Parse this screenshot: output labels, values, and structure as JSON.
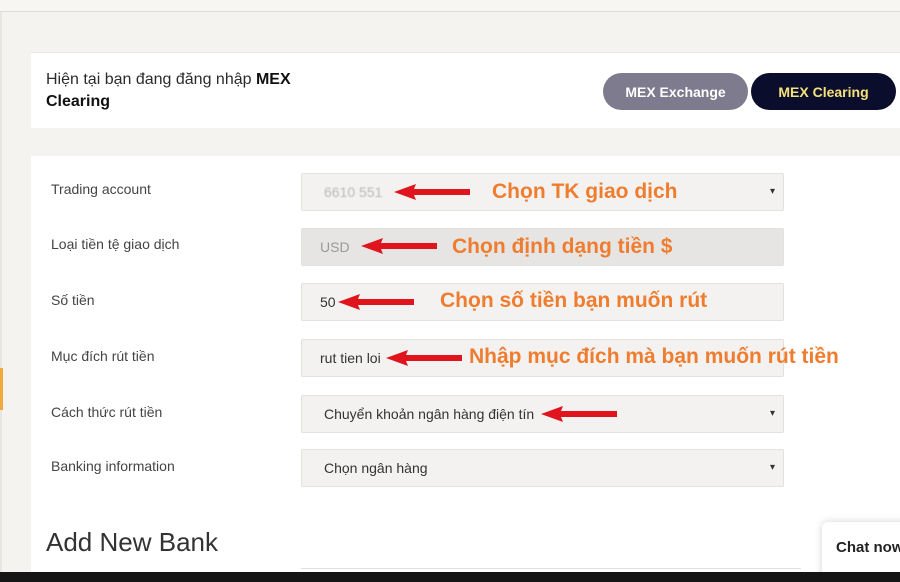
{
  "login": {
    "prefix": "Hiện tại bạn đang đăng nhập ",
    "account_bold_line1": "MEX",
    "account_bold_line2": "Clearing",
    "buttons": {
      "exchange": "MEX Exchange",
      "clearing": "MEX Clearing"
    }
  },
  "form": {
    "rows": [
      {
        "label": "Trading account",
        "value": "6610 551",
        "annotation": "Chọn TK giao dịch"
      },
      {
        "label": "Loại tiền tệ giao dịch",
        "value": "USD",
        "annotation": "Chọn định dạng tiền $"
      },
      {
        "label": "Số tiền",
        "value": "50",
        "annotation": "Chọn số tiền bạn muốn rút"
      },
      {
        "label": "Mục đích rút tiền",
        "value": "rut tien loi",
        "annotation": "Nhập mục đích mà bạn muốn rút tiền"
      },
      {
        "label": "Cách thức rút tiền",
        "value": "Chuyển khoản ngân hàng điện tín"
      },
      {
        "label": "Banking information",
        "value": "Chọn ngân hàng"
      }
    ],
    "caret": "▾"
  },
  "add_bank": {
    "title": "Add New Bank"
  },
  "chat": {
    "label": "Chat now"
  },
  "colors": {
    "annotation": "#ef7d2f",
    "arrow": "#e0141c",
    "clearing_bg": "#0b0d2c",
    "clearing_text": "#f6e27a",
    "exchange_bg": "#7d7b8d"
  },
  "icons": {
    "arrow": "red-left-arrow-icon",
    "caret": "caret-down-icon"
  }
}
